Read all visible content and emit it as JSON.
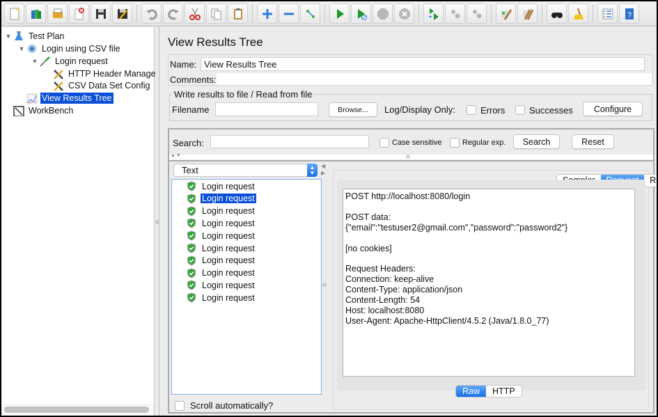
{
  "toolbar": {
    "buttons": [
      {
        "name": "new-icon",
        "group": 1
      },
      {
        "name": "templates-icon",
        "group": 1
      },
      {
        "name": "open-icon",
        "group": 1
      },
      {
        "name": "close-icon",
        "group": 1
      },
      {
        "name": "save-icon",
        "group": 1
      },
      {
        "name": "save-as-icon",
        "group": 1
      },
      {
        "name": "undo-icon",
        "group": 2
      },
      {
        "name": "redo-icon",
        "group": 2
      },
      {
        "name": "cut-icon",
        "group": 2
      },
      {
        "name": "copy-icon",
        "group": 2
      },
      {
        "name": "paste-icon",
        "group": 2
      },
      {
        "name": "expand-icon",
        "group": 3
      },
      {
        "name": "collapse-icon",
        "group": 3
      },
      {
        "name": "toggle-icon",
        "group": 3
      },
      {
        "name": "start-icon",
        "group": 4
      },
      {
        "name": "start-no-pauses-icon",
        "group": 4
      },
      {
        "name": "stop-icon",
        "group": 4
      },
      {
        "name": "shutdown-icon",
        "group": 4
      },
      {
        "name": "remote-start-all-icon",
        "group": 5
      },
      {
        "name": "remote-stop-all-icon",
        "group": 5
      },
      {
        "name": "remote-shutdown-all-icon",
        "group": 5
      },
      {
        "name": "clear-icon",
        "group": 6
      },
      {
        "name": "clear-all-icon",
        "group": 6
      },
      {
        "name": "search-icon",
        "group": 7
      },
      {
        "name": "reset-search-icon",
        "group": 7
      },
      {
        "name": "function-helper-icon",
        "group": 8
      },
      {
        "name": "help-icon",
        "group": 8
      }
    ]
  },
  "tree": {
    "items": [
      {
        "label": "Test Plan",
        "icon": "test-plan-icon",
        "level": 0,
        "expanded": true,
        "selected": false
      },
      {
        "label": "Login using CSV file",
        "icon": "thread-group-icon",
        "level": 1,
        "expanded": true,
        "selected": false
      },
      {
        "label": "Login request",
        "icon": "sampler-icon",
        "level": 2,
        "expanded": true,
        "selected": false
      },
      {
        "label": "HTTP Header Manage",
        "icon": "config-element-icon",
        "level": 3,
        "selected": false
      },
      {
        "label": "CSV Data Set Config",
        "icon": "config-element-icon",
        "level": 3,
        "selected": false
      },
      {
        "label": "View Results Tree",
        "icon": "listener-icon",
        "level": 1,
        "selected": true
      },
      {
        "label": "WorkBench",
        "icon": "workbench-icon",
        "level": 0,
        "selected": false
      }
    ]
  },
  "panel": {
    "title": "View Results Tree",
    "name_label": "Name:",
    "name_value": "View Results Tree",
    "comments_label": "Comments:",
    "comments_value": "",
    "file_group_label": "Write results to file / Read from file",
    "filename_label": "Filename",
    "filename_value": "",
    "browse_label": "Browse...",
    "log_display_label": "Log/Display Only:",
    "errors_label": "Errors",
    "errors_checked": false,
    "successes_label": "Successes",
    "successes_checked": false,
    "configure_label": "Configure"
  },
  "search": {
    "label": "Search:",
    "value": "",
    "case_sensitive_label": "Case sensitive",
    "case_sensitive_checked": false,
    "regex_label": "Regular exp.",
    "regex_checked": false,
    "search_button": "Search",
    "reset_button": "Reset"
  },
  "results": {
    "renderer": "Text",
    "items": [
      {
        "label": "Login request",
        "status": "success",
        "selected": false
      },
      {
        "label": "Login request",
        "status": "success",
        "selected": true
      },
      {
        "label": "Login request",
        "status": "success",
        "selected": false
      },
      {
        "label": "Login request",
        "status": "success",
        "selected": false
      },
      {
        "label": "Login request",
        "status": "success",
        "selected": false
      },
      {
        "label": "Login request",
        "status": "success",
        "selected": false
      },
      {
        "label": "Login request",
        "status": "success",
        "selected": false
      },
      {
        "label": "Login request",
        "status": "success",
        "selected": false
      },
      {
        "label": "Login request",
        "status": "success",
        "selected": false
      },
      {
        "label": "Login request",
        "status": "success",
        "selected": false
      }
    ],
    "scroll_auto_label": "Scroll automatically?",
    "scroll_auto_checked": false
  },
  "detail": {
    "tabs": [
      {
        "label": "Sampler result",
        "active": false
      },
      {
        "label": "Request",
        "active": true
      },
      {
        "label": "Response data",
        "active": false
      }
    ],
    "content_lines": [
      "POST http://localhost:8080/login",
      "",
      "POST data:",
      "{\"email\":\"testuser2@gmail.com\",\"password\":\"password2\"}",
      "",
      "[no cookies]",
      "",
      "Request Headers:",
      "Connection: keep-alive",
      "Content-Type: application/json",
      "Content-Length: 54",
      "Host: localhost:8080",
      "User-Agent: Apache-HttpClient/4.5.2 (Java/1.8.0_77)"
    ],
    "view_tabs": [
      {
        "label": "Raw",
        "active": true
      },
      {
        "label": "HTTP",
        "active": false
      }
    ]
  },
  "colors": {
    "selection": "#0b4fd6",
    "accent_blue": "#1a6fe6",
    "success_green": "#2fa836"
  }
}
